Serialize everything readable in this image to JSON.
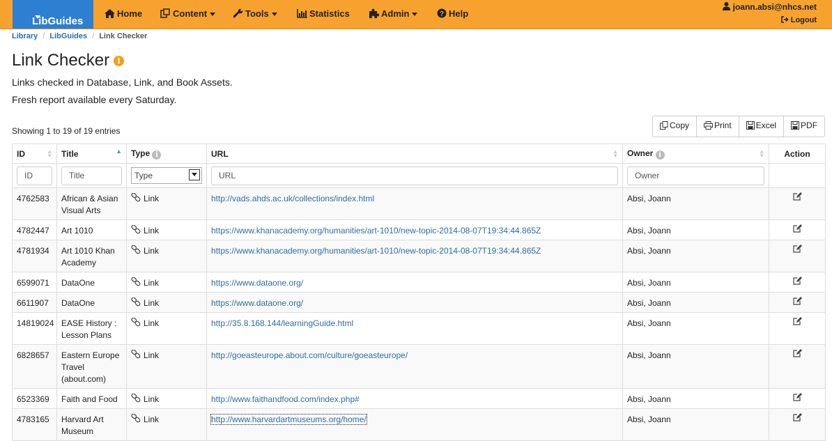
{
  "nav": {
    "brand": "LibGuides",
    "items": [
      {
        "label": "Home",
        "icon": "home-icon"
      },
      {
        "label": "Content",
        "icon": "content-icon"
      },
      {
        "label": "Tools",
        "icon": "wrench-icon"
      },
      {
        "label": "Statistics",
        "icon": "bar-chart-icon"
      },
      {
        "label": "Admin",
        "icon": "puzzle-icon"
      },
      {
        "label": "Help",
        "icon": "help-icon"
      }
    ],
    "user": "joann.absi@nhcs.net",
    "logout": "Logout"
  },
  "breadcrumb": [
    "Library",
    "LibGuides",
    "Link Checker"
  ],
  "page": {
    "title": "Link Checker",
    "line1": "Links checked in Database, Link, and Book Assets.",
    "line2": "Fresh report available every Saturday.",
    "showing": "Showing 1 to 19 of 19 entries"
  },
  "export_buttons": {
    "copy": "Copy",
    "print": "Print",
    "excel": "Excel",
    "pdf": "PDF"
  },
  "table": {
    "headers": {
      "id": "ID",
      "title": "Title",
      "type": "Type",
      "url": "URL",
      "owner": "Owner",
      "action": "Action"
    },
    "filters": {
      "id": "ID",
      "title": "Title",
      "type": "Type",
      "url": "URL",
      "owner": "Owner"
    },
    "rows": [
      {
        "id": "4762583",
        "title": "African & Asian Visual Arts",
        "type": "Link",
        "url": "http://vads.ahds.ac.uk/collections/index.html",
        "owner": "Absi, Joann"
      },
      {
        "id": "4782447",
        "title": "Art 1010",
        "type": "Link",
        "url": "https://www.khanacademy.org/humanities/art-1010/new-topic-2014-08-07T19:34:44.865Z",
        "owner": "Absi, Joann"
      },
      {
        "id": "4781934",
        "title": "Art 1010 Khan Academy",
        "type": "Link",
        "url": "https://www.khanacademy.org/humanities/art-1010/new-topic-2014-08-07T19:34:44.865Z",
        "owner": "Absi, Joann"
      },
      {
        "id": "6599071",
        "title": "DataOne",
        "type": "Link",
        "url": "https://www.dataone.org/",
        "owner": "Absi, Joann"
      },
      {
        "id": "6611907",
        "title": "DataOne",
        "type": "Link",
        "url": "https://www.dataone.org/",
        "owner": "Absi, Joann"
      },
      {
        "id": "14819024",
        "title": "EASE History : Lesson Plans",
        "type": "Link",
        "url": "http://35.8.168.144/learningGuide.html",
        "owner": "Absi, Joann"
      },
      {
        "id": "6828657",
        "title": "Eastern Europe Travel (about.com)",
        "type": "Link",
        "url": "http://goeasteurope.about.com/culture/goeasteurope/",
        "owner": "Absi, Joann"
      },
      {
        "id": "6523369",
        "title": "Faith and Food",
        "type": "Link",
        "url": "http://www.faithandfood.com/index.php#",
        "owner": "Absi, Joann"
      },
      {
        "id": "4783165",
        "title": "Harvard Art Museum",
        "type": "Link",
        "url": "http://www.harvardartmuseums.org/home/",
        "owner": "Absi, Joann"
      }
    ]
  }
}
